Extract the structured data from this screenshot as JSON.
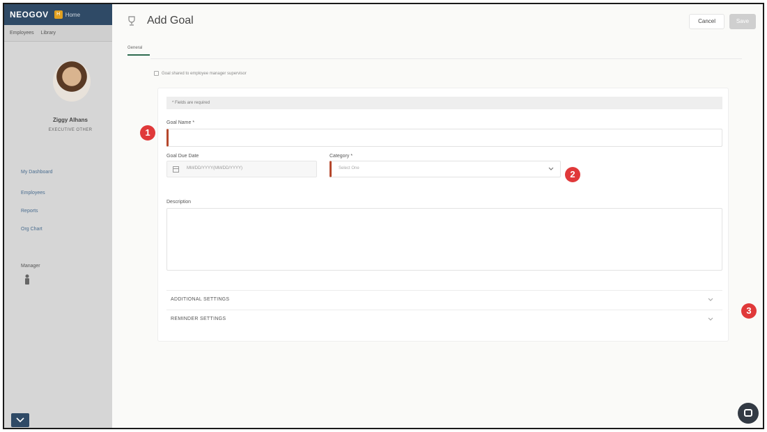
{
  "sidebar": {
    "logo": "NEOGOV",
    "app_name": "Home",
    "subnav": [
      "Employees",
      "Library"
    ],
    "user": {
      "name": "Ziggy Alhans",
      "title": "EXECUTIVE OTHER"
    },
    "nav": [
      "My Dashboard",
      "Employees",
      "Reports",
      "Org Chart"
    ],
    "manager_label": "Manager",
    "collapse_icon": "chevron-down-icon"
  },
  "header": {
    "title": "Add Goal",
    "cancel_label": "Cancel",
    "save_label": "Save",
    "tab": "General"
  },
  "form": {
    "notice": "Goal shared to employee manager supervisor",
    "required_note": "* Fields are required",
    "goal_name_label": "Goal Name *",
    "due_date_label": "Goal Due Date",
    "due_date_placeholder": "MM/DD/YYYY(MM/DD/YYYY)",
    "category_label": "Category *",
    "category_placeholder": "Select One",
    "description_label": "Description",
    "additional_settings": "ADDITIONAL SETTINGS",
    "reminder_settings": "REMINDER SETTINGS"
  },
  "markers": [
    "1",
    "2",
    "3"
  ],
  "colors": {
    "brand_nav": "#2f4a66",
    "required_accent": "#b5472c",
    "marker": "#e0393a",
    "tab_accent": "#2d6b4f"
  }
}
